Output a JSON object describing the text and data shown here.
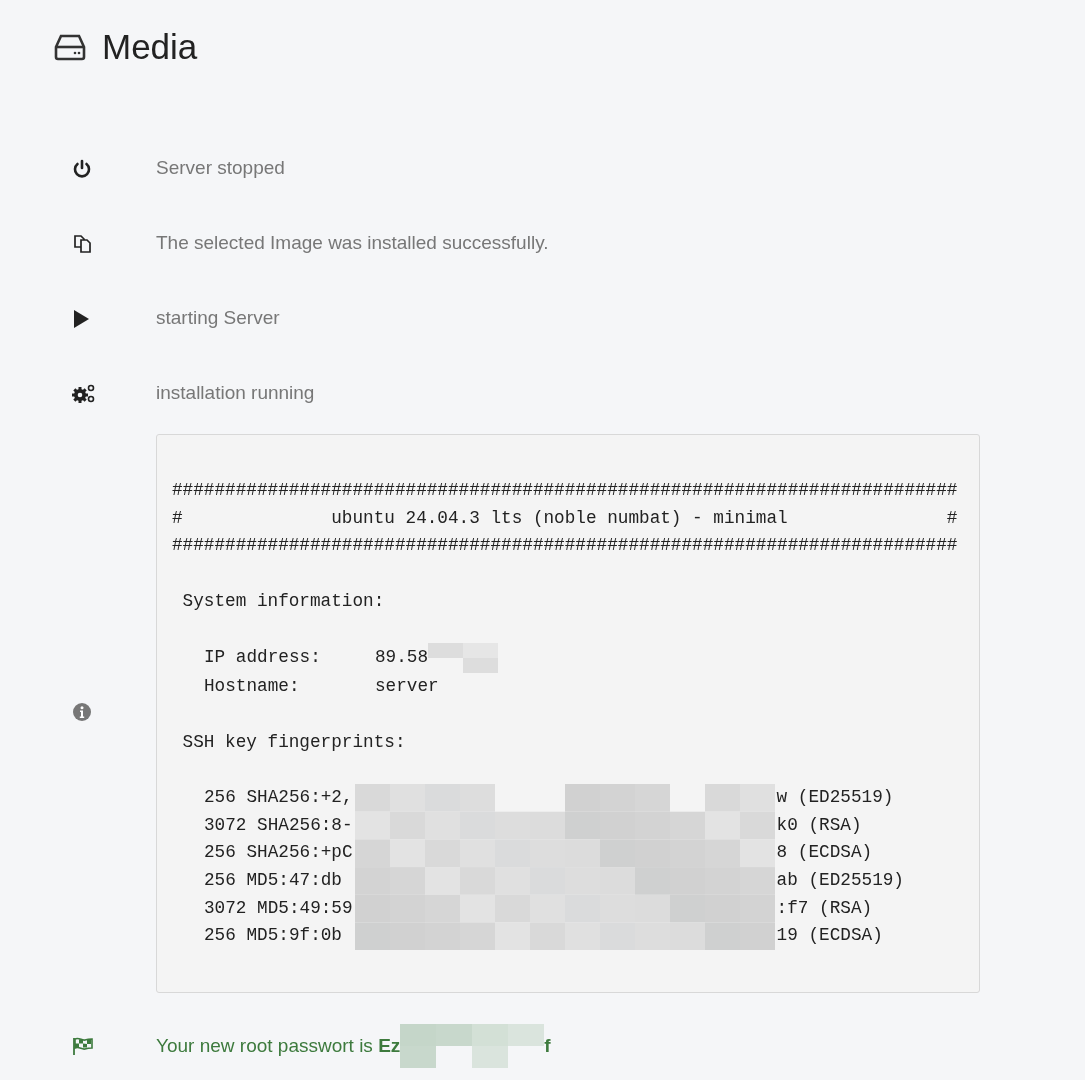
{
  "title": "Media",
  "log": [
    {
      "kind": "power",
      "text": "Server stopped"
    },
    {
      "kind": "copy",
      "text": "The selected Image was installed successfully."
    },
    {
      "kind": "play",
      "text": "starting Server"
    },
    {
      "kind": "gears",
      "text": "installation running"
    },
    {
      "kind": "console",
      "banner": [
        "##########################################################################",
        "#              ubuntu 24.04.3 lts (noble numbat) - minimal               #",
        "##########################################################################"
      ],
      "system_heading": " System information:",
      "system_rows": [
        {
          "label": "IP address:",
          "value": "89.58",
          "redacted": true
        },
        {
          "label": "Hostname:",
          "value": "server",
          "redacted": false
        }
      ],
      "ssh_heading": " SSH key fingerprints:",
      "fingerprints": [
        {
          "start": "256 SHA256:+2,",
          "end": "w (ED25519)"
        },
        {
          "start": "3072 SHA256:8-",
          "end": "k0 (RSA)"
        },
        {
          "start": "256 SHA256:+pC",
          "end": "8 (ECDSA)"
        },
        {
          "start": "256 MD5:47:db",
          "end": "ab (ED25519)"
        },
        {
          "start": "3072 MD5:49:59",
          "end": ":f7 (RSA)"
        },
        {
          "start": "256 MD5:9f:0b",
          "end": "19 (ECDSA)"
        }
      ]
    },
    {
      "kind": "flag",
      "text": "Your new root passwort is **Ez**",
      "text_end": "f",
      "redacted": true
    }
  ]
}
